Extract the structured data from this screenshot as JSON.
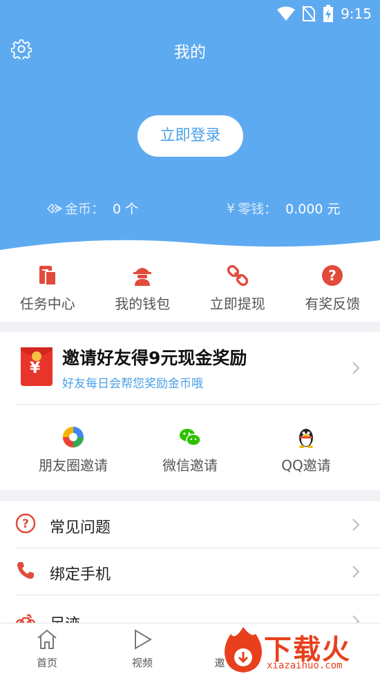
{
  "status_bar": {
    "time": "9:15"
  },
  "header": {
    "title": "我的",
    "login_label": "立即登录",
    "coins_label": "金币：",
    "coins_value": "0 个",
    "cash_label": "零钱：",
    "cash_value": "0.000 元",
    "background_color": "#5eaaf0"
  },
  "quick_actions": [
    {
      "label": "任务中心",
      "icon": "task-clipboard-icon"
    },
    {
      "label": "我的钱包",
      "icon": "wallet-agent-icon"
    },
    {
      "label": "立即提现",
      "icon": "link-chain-icon"
    },
    {
      "label": "有奖反馈",
      "icon": "question-circle-icon"
    }
  ],
  "invite": {
    "title": "邀请好友得9元现金奖励",
    "subtitle": "好友每日会帮您奖励金币哦",
    "red_packet_symbol": "¥",
    "share_options": [
      {
        "label": "朋友圈邀请",
        "icon": "moments-aperture-icon"
      },
      {
        "label": "微信邀请",
        "icon": "wechat-icon"
      },
      {
        "label": "QQ邀请",
        "icon": "qq-penguin-icon"
      }
    ]
  },
  "menu": [
    {
      "label": "常见问题",
      "icon": "question-circle-outline-icon"
    },
    {
      "label": "绑定手机",
      "icon": "phone-icon"
    },
    {
      "label": "足迹",
      "icon": "motorcycle-icon"
    }
  ],
  "bottom_nav": [
    {
      "label": "首页",
      "icon": "home-icon"
    },
    {
      "label": "视频",
      "icon": "play-icon"
    },
    {
      "label": "邀",
      "icon": "invite-icon"
    }
  ],
  "watermark": {
    "text": "下载火",
    "sub": "xiazaihuo.com"
  },
  "colors": {
    "accent": "#4a9fe8",
    "red": "#e24a3b",
    "wechat_green": "#2dc100"
  }
}
